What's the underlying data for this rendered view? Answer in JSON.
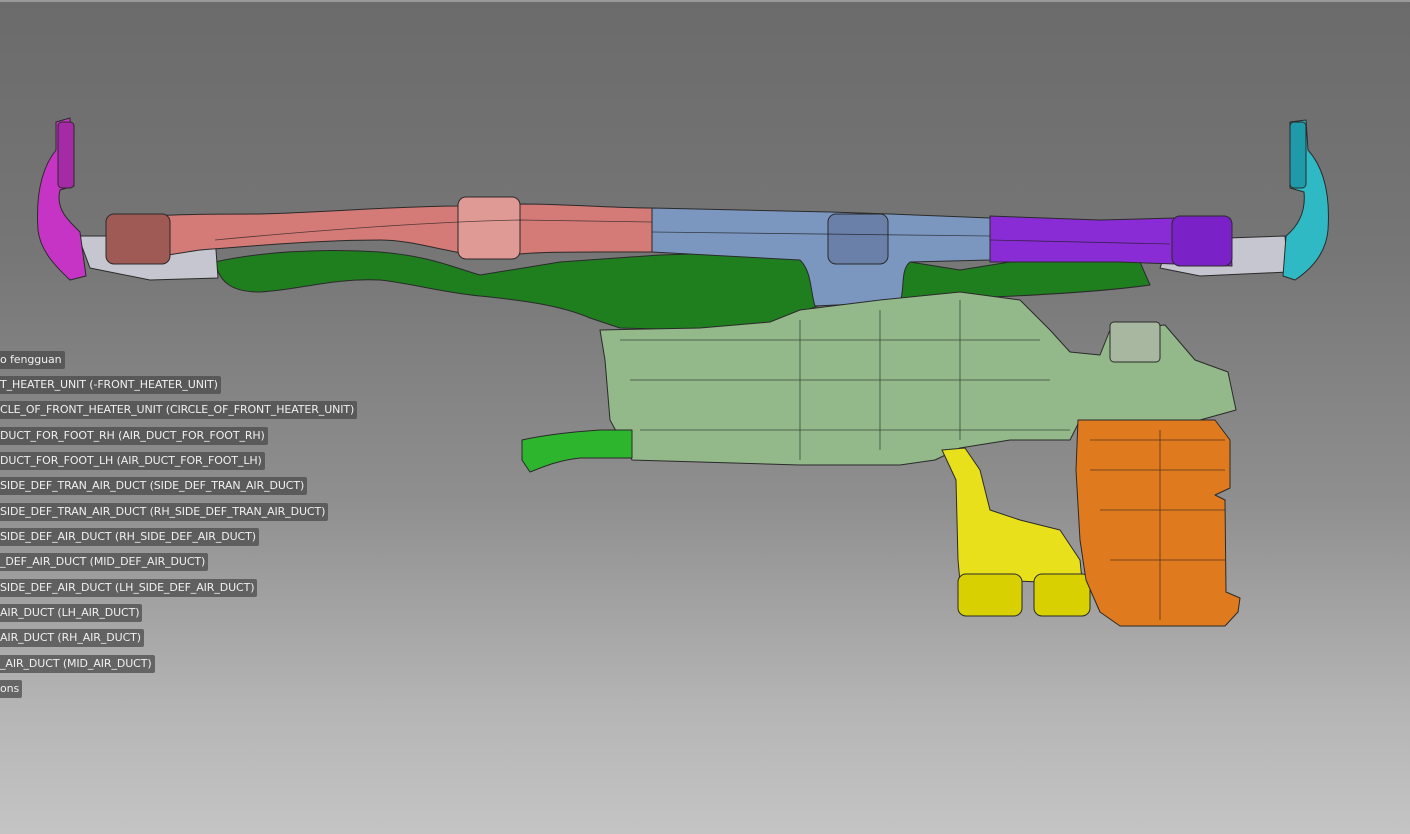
{
  "viewport": {
    "description_icon": "3d-assembly-model"
  },
  "tree": {
    "items": [
      "o fengguan",
      "T_HEATER_UNIT (-FRONT_HEATER_UNIT)",
      "CLE_OF_FRONT_HEATER_UNIT (CIRCLE_OF_FRONT_HEATER_UNIT)",
      "DUCT_FOR_FOOT_RH (AIR_DUCT_FOR_FOOT_RH)",
      "DUCT_FOR_FOOT_LH (AIR_DUCT_FOR_FOOT_LH)",
      "SIDE_DEF_TRAN_AIR_DUCT (SIDE_DEF_TRAN_AIR_DUCT)",
      "SIDE_DEF_TRAN_AIR_DUCT (RH_SIDE_DEF_TRAN_AIR_DUCT)",
      "SIDE_DEF_AIR_DUCT (RH_SIDE_DEF_AIR_DUCT)",
      "_DEF_AIR_DUCT (MID_DEF_AIR_DUCT)",
      "SIDE_DEF_AIR_DUCT (LH_SIDE_DEF_AIR_DUCT)",
      "AIR_DUCT (LH_AIR_DUCT)",
      "AIR_DUCT (RH_AIR_DUCT)",
      "_AIR_DUCT (MID_AIR_DUCT)",
      "ons"
    ]
  },
  "colors": {
    "lh_side_def": "#c634c6",
    "rh_side_def": "#2fb9c4",
    "lh_air_duct": "#d47a77",
    "mid_air_duct": "#7b97c0",
    "rh_air_duct": "#8a2cd6",
    "mid_def_duct": "#1f7f1f",
    "heater_unit": "#93b88a",
    "foot_lh": "#2eb52e",
    "foot_rh": "#e8e01a",
    "blower": "#e07a1f",
    "silver": "#c6c6d0"
  }
}
